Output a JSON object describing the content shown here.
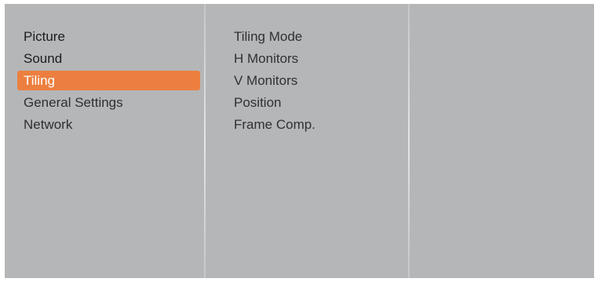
{
  "main_menu": {
    "items": [
      {
        "label": "Picture"
      },
      {
        "label": "Sound"
      },
      {
        "label": "Tiling"
      },
      {
        "label": "General Settings"
      },
      {
        "label": "Network"
      }
    ],
    "selected_index": 2
  },
  "submenu": {
    "items": [
      {
        "label": "Tiling Mode"
      },
      {
        "label": "H Monitors"
      },
      {
        "label": "V Monitors"
      },
      {
        "label": "Position"
      },
      {
        "label": "Frame Comp."
      }
    ]
  },
  "colors": {
    "panel_background": "#b5b6b8",
    "selection_highlight": "#ec7f3f",
    "selected_text": "#ffffff"
  }
}
